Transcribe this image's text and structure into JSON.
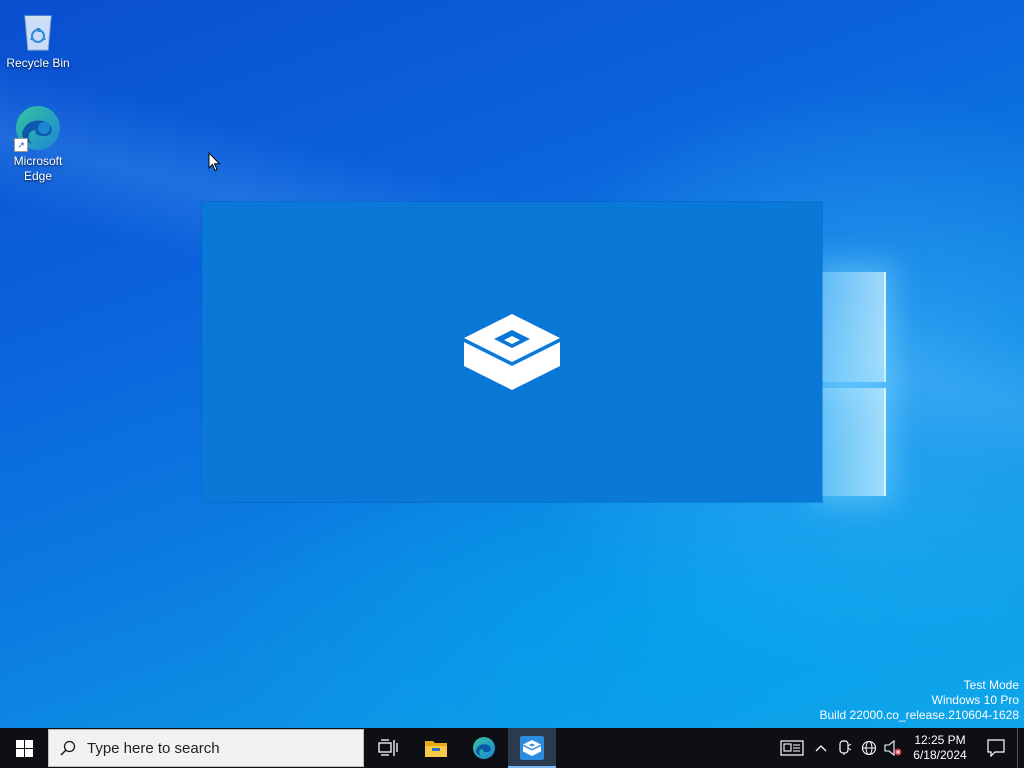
{
  "desktop": {
    "icons": [
      {
        "label": "Recycle Bin",
        "icon": "recycle-bin-icon"
      },
      {
        "label": "Microsoft\nEdge",
        "icon": "edge-icon"
      }
    ],
    "watermark": {
      "line1": "Test Mode",
      "line2": "Windows 10 Pro",
      "line3": "Build 22000.co_release.210604-1628"
    }
  },
  "sandbox_window": {
    "icon": "windows-sandbox-icon",
    "background_color": "#0a78d6"
  },
  "taskbar": {
    "start_icon": "windows-start-icon",
    "search": {
      "placeholder": "Type here to search",
      "icon": "search-icon"
    },
    "apps": [
      {
        "name": "Task View",
        "icon": "task-view-icon",
        "active": false
      },
      {
        "name": "File Explorer",
        "icon": "file-explorer-icon",
        "active": false
      },
      {
        "name": "Microsoft Edge",
        "icon": "edge-icon",
        "active": false
      },
      {
        "name": "Windows Sandbox",
        "icon": "windows-sandbox-icon",
        "active": true
      }
    ],
    "tray": {
      "icons": [
        "news-widget-icon",
        "chevron-up-icon",
        "meet-now-icon",
        "network-icon",
        "volume-muted-icon"
      ],
      "time": "12:25 PM",
      "date": "6/18/2024",
      "notification_icon": "notification-icon"
    }
  },
  "colors": {
    "taskbar": "#0d0f14",
    "accent": "#0a78d6",
    "active_indicator": "#79b8f3"
  }
}
